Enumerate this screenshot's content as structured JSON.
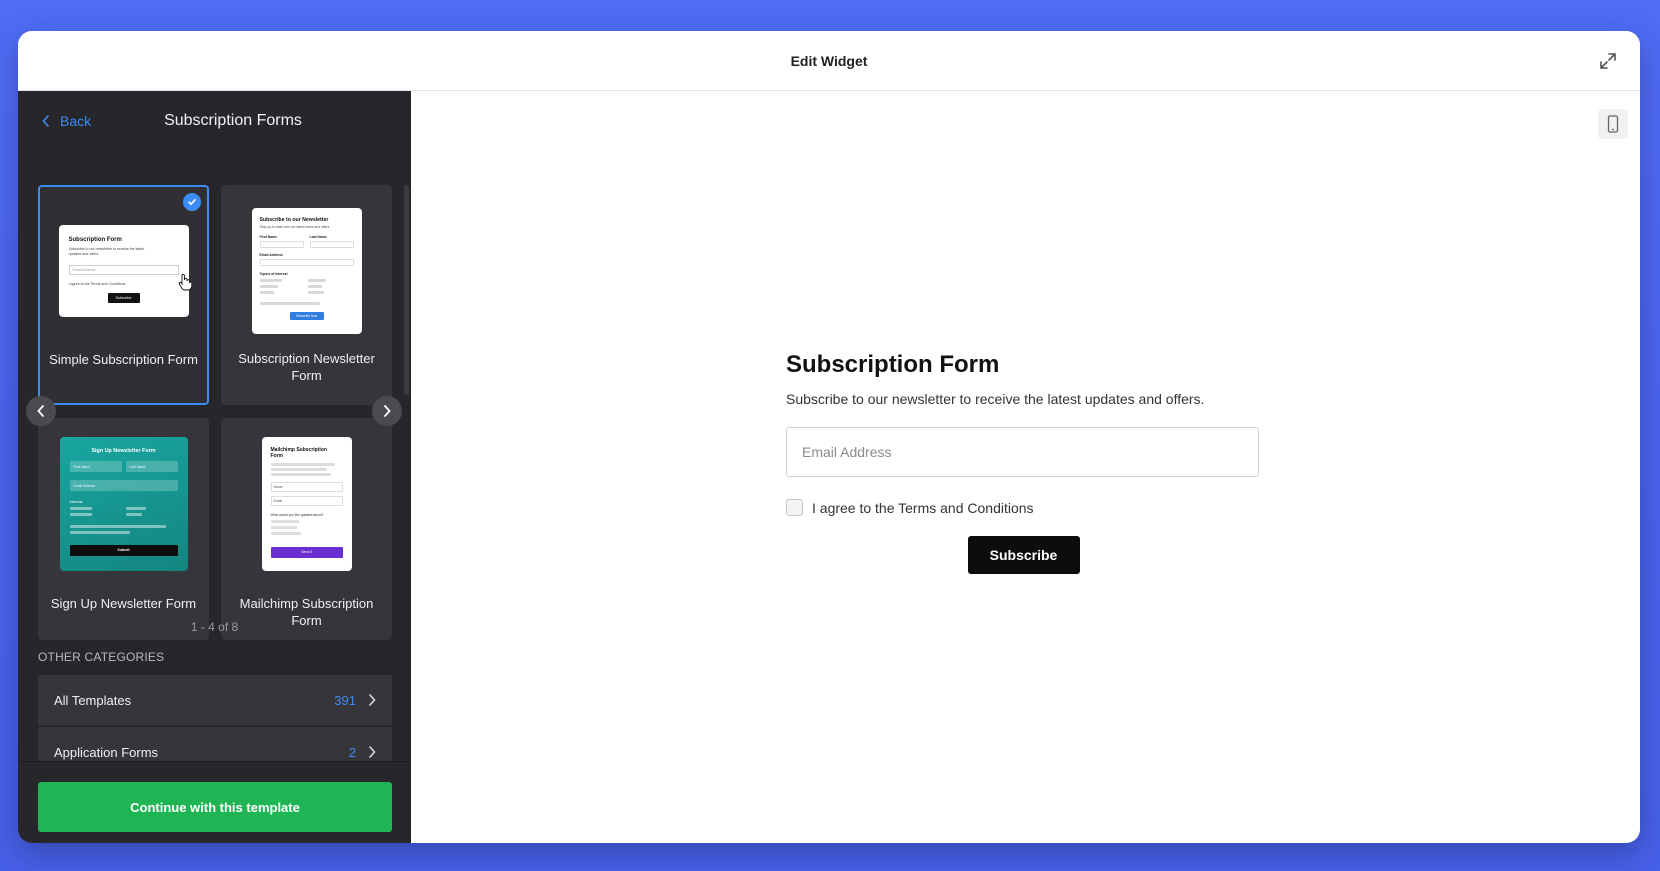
{
  "modal": {
    "title": "Edit Widget"
  },
  "sidebar": {
    "back_label": "Back",
    "title": "Subscription Forms",
    "templates": [
      {
        "label": "Simple Subscription Form",
        "selected": true,
        "thumb": {
          "title": "Subscription Form",
          "desc": "Subscribe to our newsletter to receive the latest updates and offers.",
          "field": "Email Address",
          "agree": "I agree to the Terms and Conditions",
          "button": "Subscribe"
        }
      },
      {
        "label": "Subscription Newsletter Form",
        "selected": false,
        "thumb": {
          "title": "Subscribe to our Newsletter",
          "desc": "Stay up-to-date with our latest news and offers",
          "first_name": "First Name",
          "last_name": "Last Name",
          "email": "Email Address",
          "topics": "Topics of Interest",
          "button": "Subscribe Now"
        }
      },
      {
        "label": "Sign Up Newsletter Form",
        "selected": false,
        "thumb": {
          "title": "Sign Up Newsletter Form",
          "first": "First Name",
          "last": "Last Name",
          "email": "Email Address",
          "interests": "Interests",
          "button": "Submit"
        }
      },
      {
        "label": "Mailchimp Subscription Form",
        "selected": false,
        "thumb": {
          "title": "Mailchimp Subscription Form",
          "name": "Name",
          "email": "Email",
          "question": "What would you like updates about?",
          "button": "Send it"
        }
      }
    ],
    "page_count": "1 - 4 of 8",
    "other_categories_label": "OTHER CATEGORIES",
    "categories": [
      {
        "name": "All Templates",
        "count": "391"
      },
      {
        "name": "Application Forms",
        "count": "2"
      }
    ],
    "continue_label": "Continue with this template"
  },
  "preview": {
    "form_title": "Subscription Form",
    "form_subtitle": "Subscribe to our newsletter to receive the latest updates and offers.",
    "email_placeholder": "Email Address",
    "agree_label": "I agree to the Terms and Conditions",
    "subscribe_label": "Subscribe"
  },
  "colors": {
    "accent": "#3b8cf7",
    "continue": "#1fb554",
    "sidebar_bg": "#27272b",
    "page_bg": "#4a63ee"
  }
}
